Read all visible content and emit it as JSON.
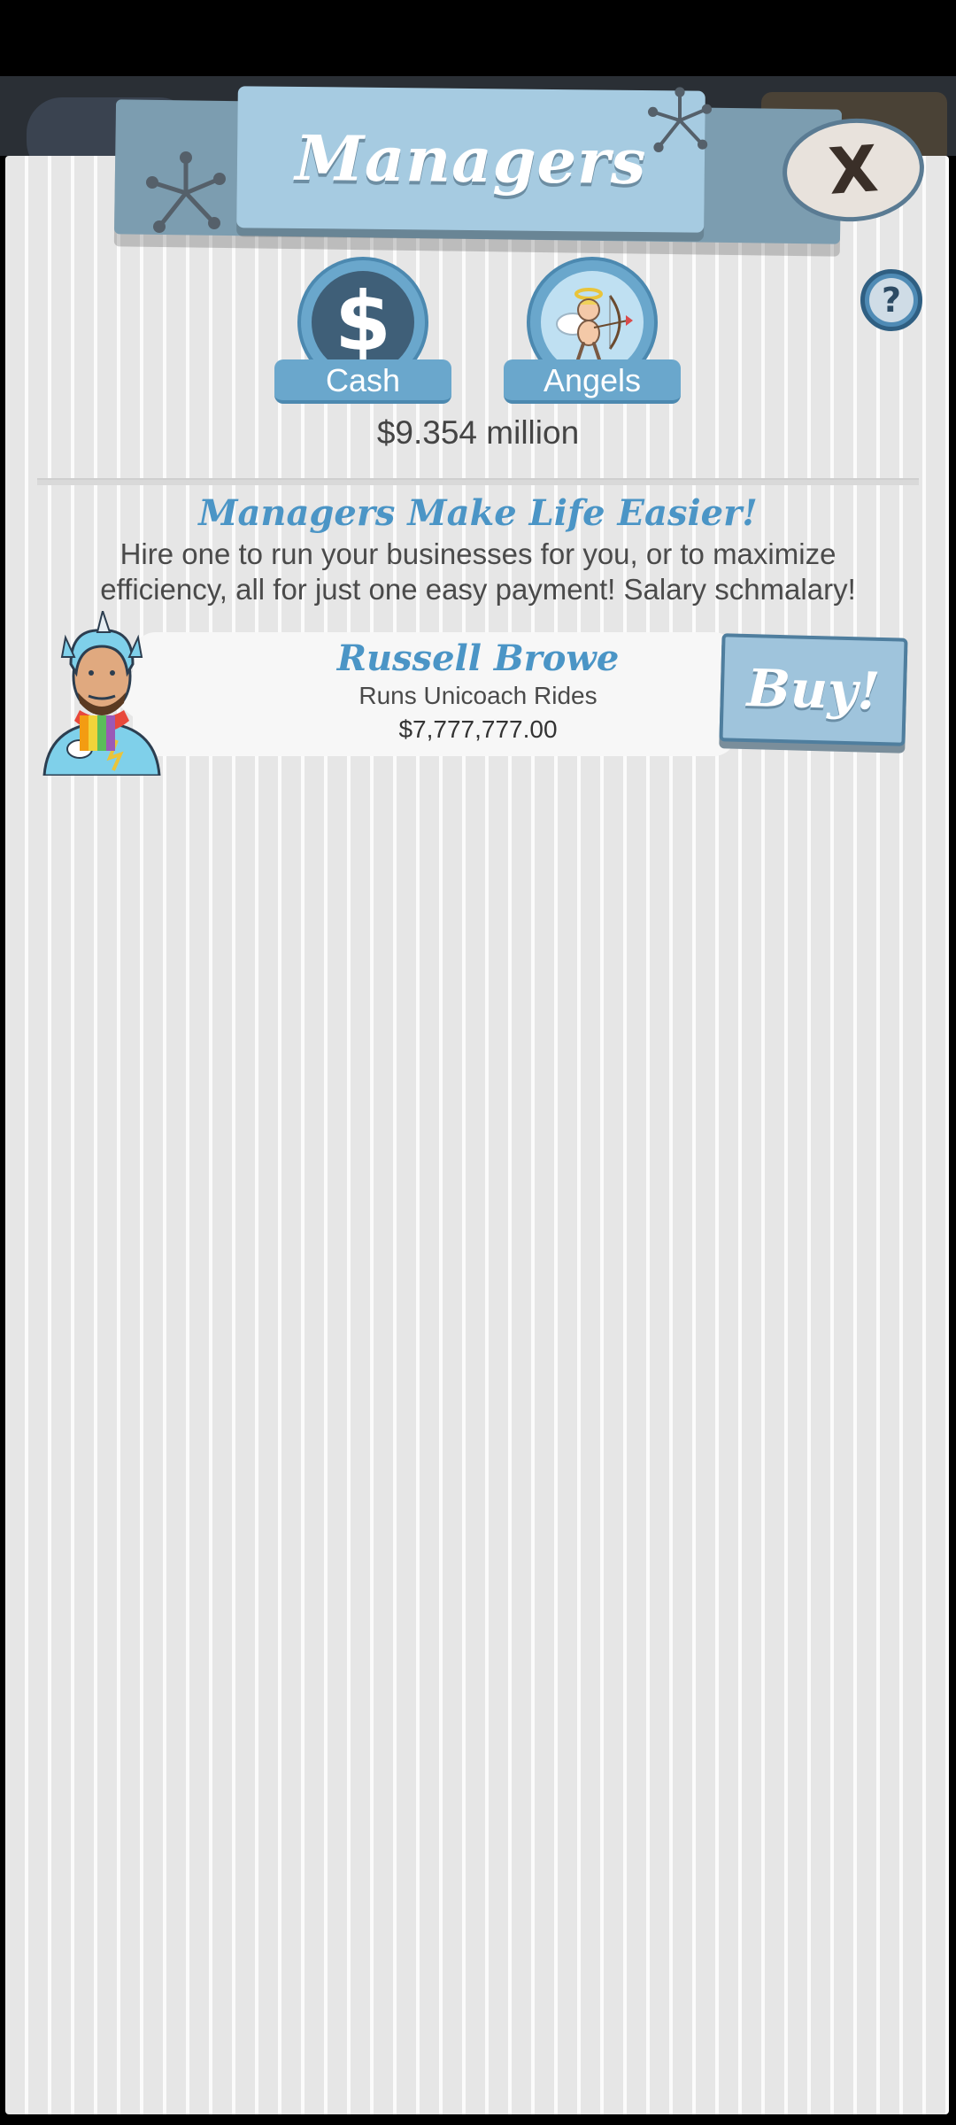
{
  "header": {
    "title": "Managers",
    "close_label": "X"
  },
  "help": {
    "icon_text": "?"
  },
  "tabs": [
    {
      "name": "cash",
      "label": "Cash",
      "icon": "dollar-icon",
      "icon_text": "$"
    },
    {
      "name": "angels",
      "label": "Angels",
      "icon": "cupid-angel-icon"
    }
  ],
  "cash_amount": "$9.354 million",
  "tagline": {
    "title": "Managers Make Life Easier!",
    "body": "Hire one to run your businesses for you, or to maximize efficiency, all for just one easy payment! Salary schmalary!"
  },
  "managers": [
    {
      "name": "Russell Browe",
      "role": "Runs Unicoach Rides",
      "price": "$7,777,777.00",
      "buy_label": "Buy!",
      "avatar": "unicorn-hat-man-avatar"
    }
  ],
  "colors": {
    "accent_blue": "#4b95c6",
    "header_blue": "#a6cbe1",
    "panel_bg": "#ededed"
  }
}
